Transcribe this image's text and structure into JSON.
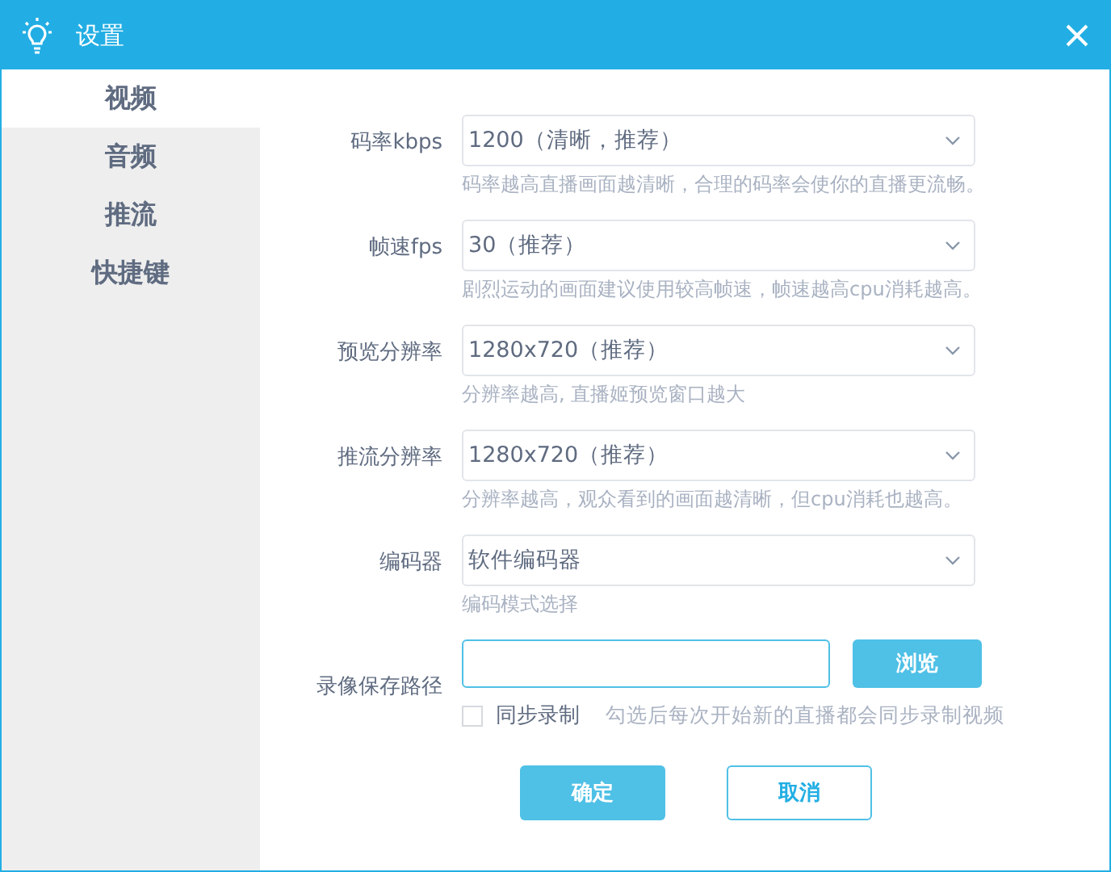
{
  "window": {
    "title": "设置"
  },
  "sidebar": {
    "items": [
      {
        "label": "视频",
        "selected": true
      },
      {
        "label": "音频",
        "selected": false
      },
      {
        "label": "推流",
        "selected": false
      },
      {
        "label": "快捷键",
        "selected": false
      }
    ]
  },
  "settings": [
    {
      "label": "码率kbps",
      "value": "1200（清晰，推荐）",
      "hint": "码率越高直播画面越清晰，合理的码率会使你的直播更流畅。"
    },
    {
      "label": "帧速fps",
      "value": "30（推荐）",
      "hint": "剧烈运动的画面建议使用较高帧速，帧速越高cpu消耗越高。"
    },
    {
      "label": "预览分辨率",
      "value": "1280x720（推荐）",
      "hint": "分辨率越高, 直播姬预览窗口越大"
    },
    {
      "label": "推流分辨率",
      "value": "1280x720（推荐）",
      "hint": "分辨率越高，观众看到的画面越清晰，但cpu消耗也越高。"
    },
    {
      "label": "编码器",
      "value": "软件编码器",
      "hint": "编码模式选择"
    }
  ],
  "record": {
    "label": "录像保存路径",
    "browse": "浏览",
    "sync": {
      "label": "同步录制",
      "checked": false
    },
    "sync_hint": "勾选后每次开始新的直播都会同步录制视频"
  },
  "buttons": [
    {
      "label": "确定",
      "kind": "primary"
    },
    {
      "label": "取消",
      "kind": "secondary"
    }
  ]
}
